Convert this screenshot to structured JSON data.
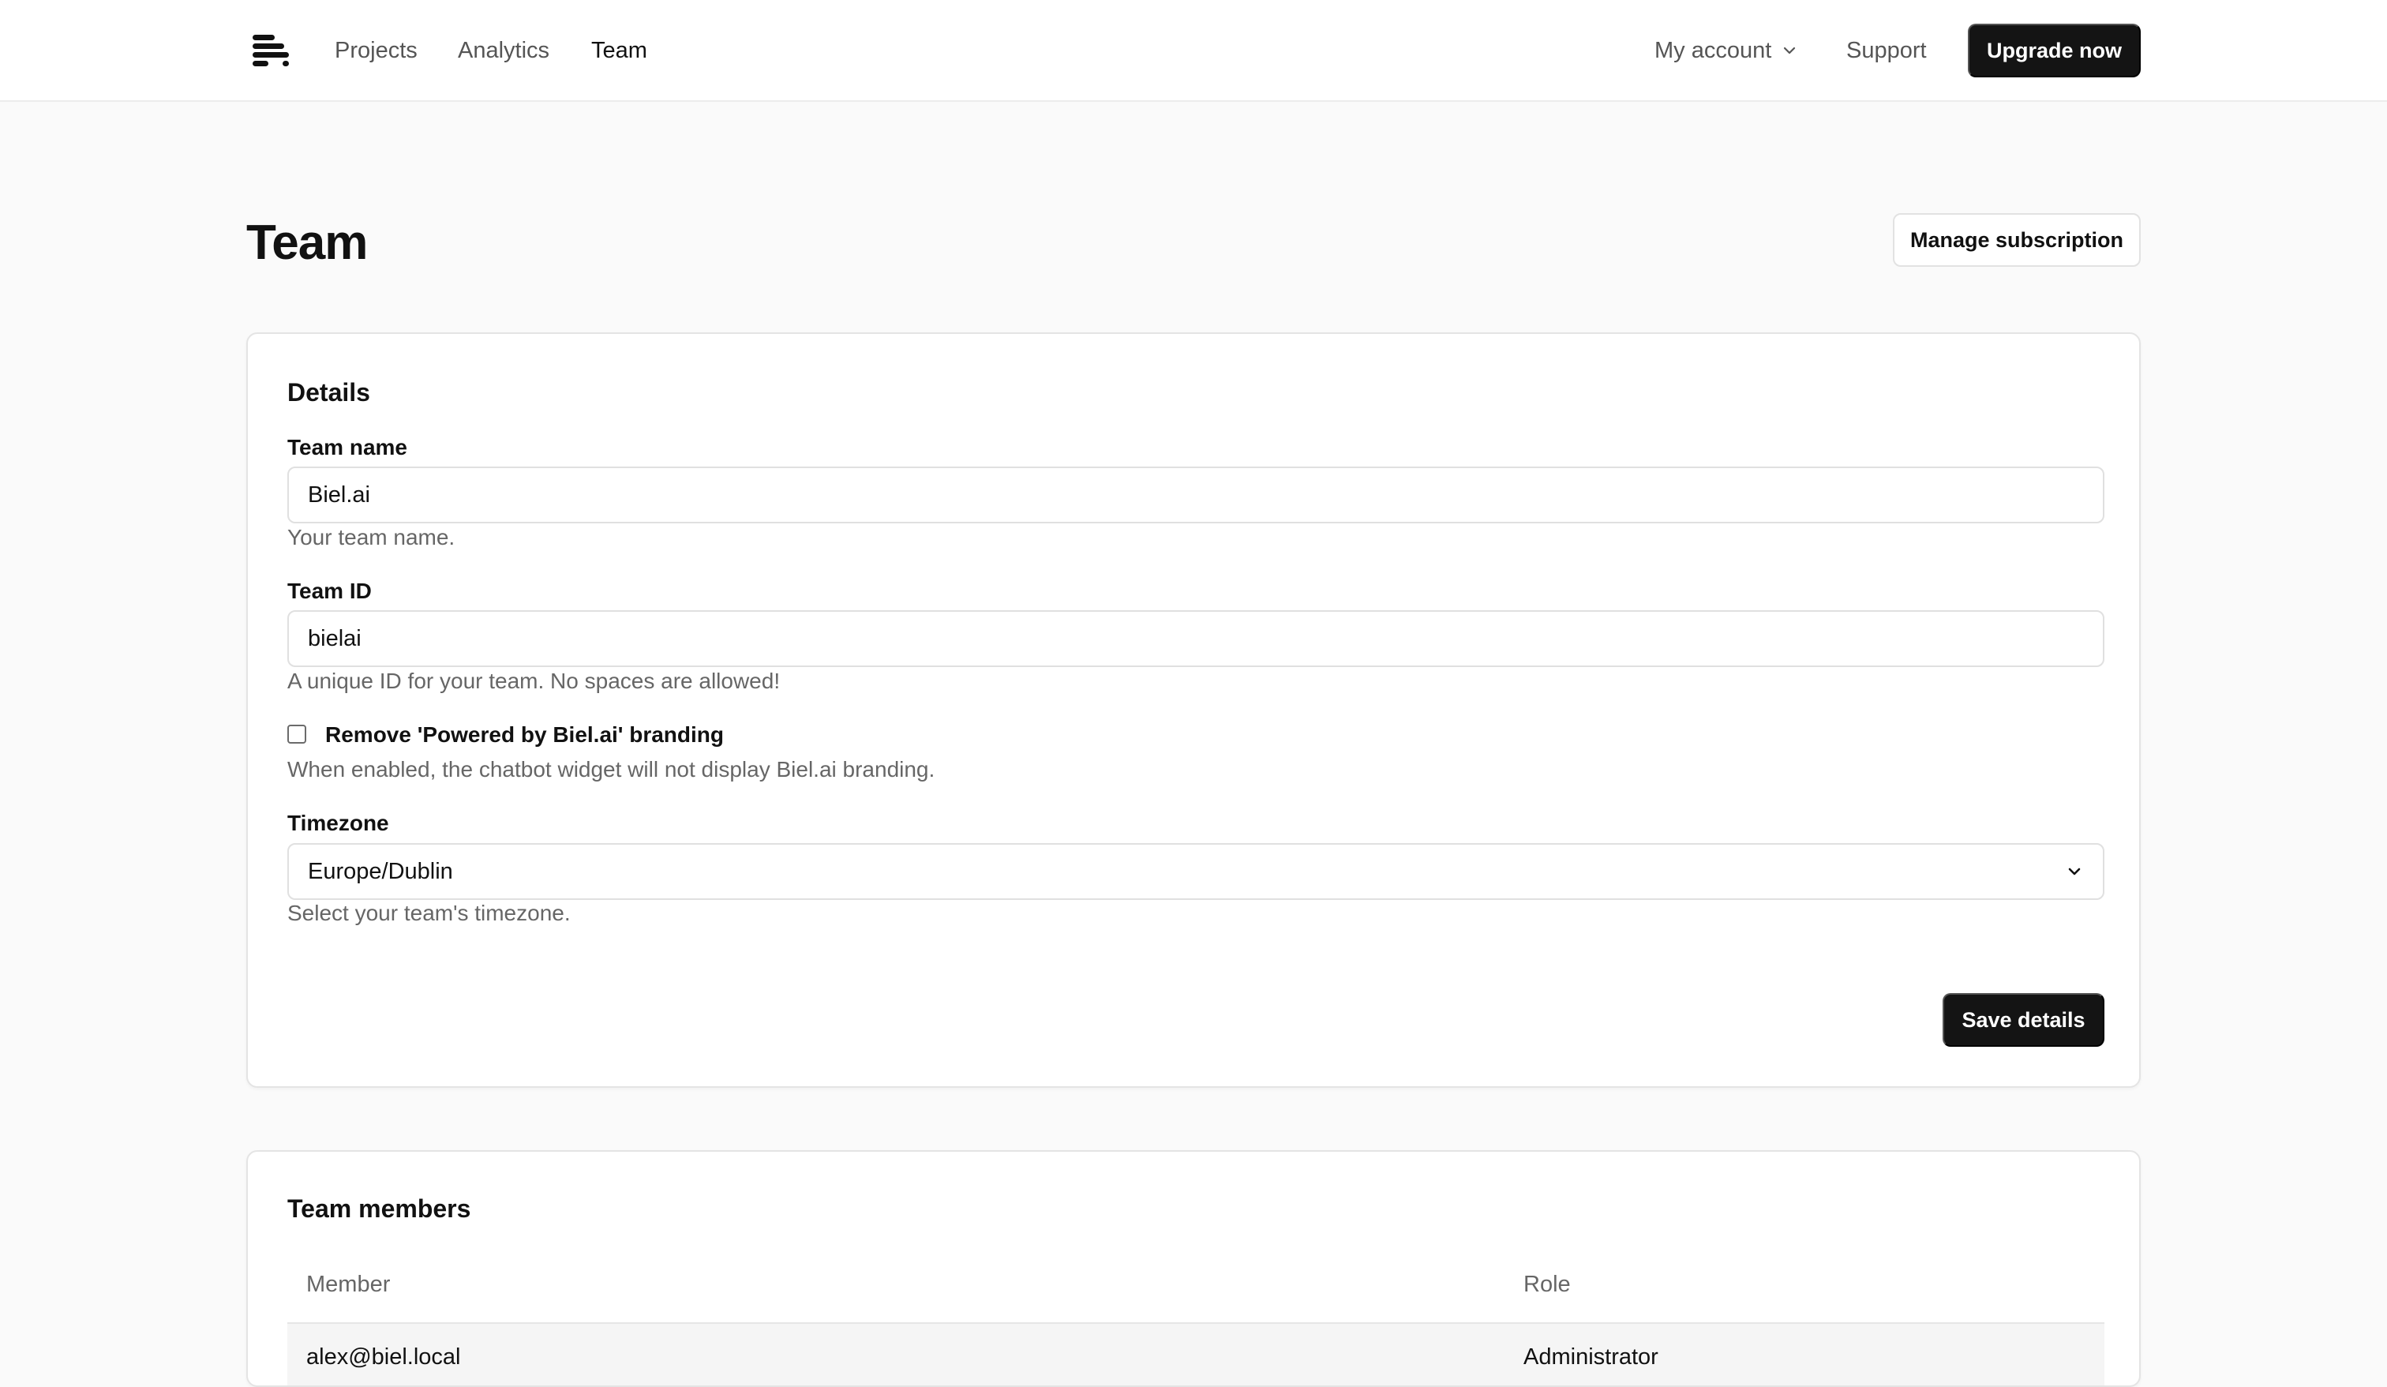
{
  "nav": {
    "links": [
      {
        "label": "Projects"
      },
      {
        "label": "Analytics"
      },
      {
        "label": "Team"
      }
    ],
    "account_label": "My account",
    "support_label": "Support",
    "upgrade_label": "Upgrade now"
  },
  "page": {
    "title": "Team",
    "manage_subscription_label": "Manage subscription"
  },
  "details": {
    "title": "Details",
    "team_name": {
      "label": "Team name",
      "value": "Biel.ai",
      "help": "Your team name."
    },
    "team_id": {
      "label": "Team ID",
      "value": "bielai",
      "help": "A unique ID for your team. No spaces are allowed!"
    },
    "branding": {
      "label": "Remove 'Powered by Biel.ai' branding",
      "checked": false,
      "help": "When enabled, the chatbot widget will not display Biel.ai branding."
    },
    "timezone": {
      "label": "Timezone",
      "value": "Europe/Dublin",
      "help": "Select your team's timezone."
    },
    "save_label": "Save details"
  },
  "members": {
    "title": "Team members",
    "columns": {
      "member": "Member",
      "role": "Role"
    },
    "rows": [
      {
        "member": "alex@biel.local",
        "role": "Administrator"
      }
    ]
  }
}
